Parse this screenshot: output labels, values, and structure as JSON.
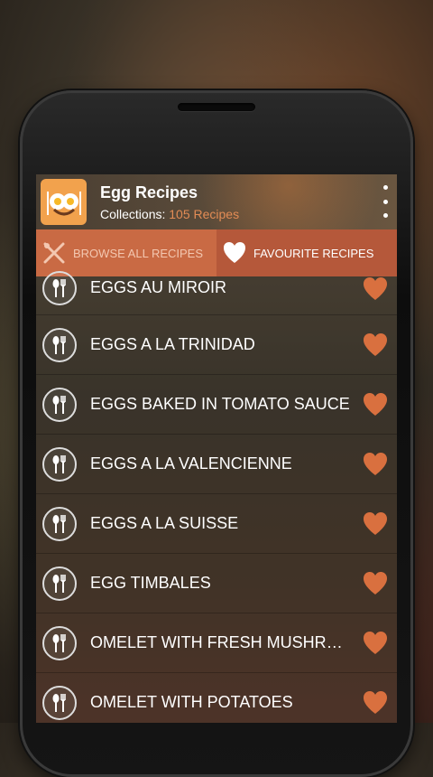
{
  "app": {
    "title": "Egg Recipes",
    "subtitle_label": "Collections:",
    "subtitle_count": "105 Recipes",
    "accent": "#e38c55"
  },
  "tabs": [
    {
      "label": "BROWSE ALL RECIPES",
      "icon": "fork-knife-icon",
      "active": false
    },
    {
      "label": "FAVOURITE RECIPES",
      "icon": "heart-icon",
      "active": true
    }
  ],
  "recipes": [
    {
      "title": "EGGS AU MIROIR"
    },
    {
      "title": "EGGS A LA TRINIDAD"
    },
    {
      "title": "EGGS BAKED IN TOMATO SAUCE"
    },
    {
      "title": "EGGS A LA VALENCIENNE"
    },
    {
      "title": "EGGS A LA SUISSE"
    },
    {
      "title": "EGG TIMBALES"
    },
    {
      "title": "OMELET WITH FRESH MUSHRO..."
    },
    {
      "title": "OMELET WITH POTATOES"
    }
  ],
  "colors": {
    "tab_bar": "#c4633f",
    "heart": "#d9703f"
  }
}
